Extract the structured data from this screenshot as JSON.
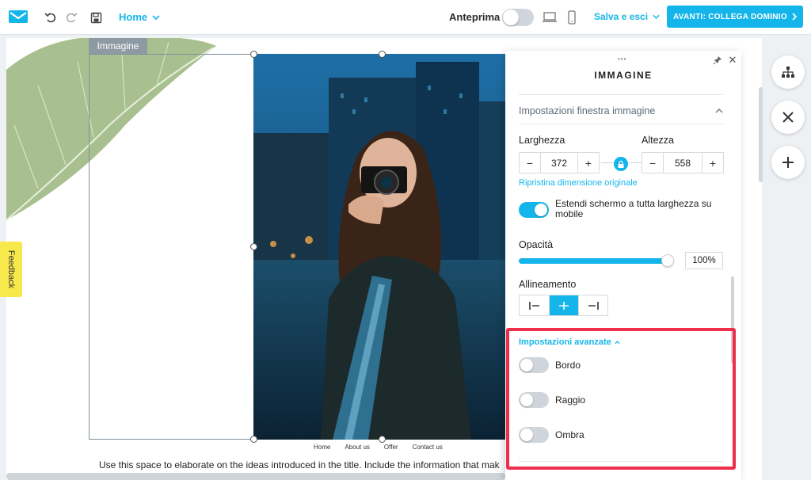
{
  "topbar": {
    "page_selector": "Home",
    "preview_label": "Anteprima",
    "save_label": "Salva e esci",
    "next_label": "AVANTI: COLLEGA DOMINIO"
  },
  "canvas": {
    "image_tag": "Immagine",
    "footer_links": [
      "Home",
      "About us",
      "Offer",
      "Contact us"
    ],
    "body_text": "Use this space to elaborate on the ideas introduced in the title. Include the information that mak"
  },
  "feedback_label": "Feedback",
  "panel": {
    "title": "IMMAGINE",
    "section_title": "Impostazioni finestra immagine",
    "width_label": "Larghezza",
    "height_label": "Altezza",
    "width_value": "372",
    "height_value": "558",
    "reset_link": "Ripristina dimensione originale",
    "fullwidth_label": "Estendi schermo a tutta larghezza su mobile",
    "opacity_label": "Opacità",
    "opacity_value": "100%",
    "opacity_level": 1.0,
    "alignment_label": "Allineamento",
    "advanced_label": "Impostazioni avanzate",
    "toggles": [
      {
        "label": "Bordo",
        "on": false
      },
      {
        "label": "Raggio",
        "on": false
      },
      {
        "label": "Ombra",
        "on": false
      }
    ]
  },
  "colors": {
    "accent": "#13b5ea",
    "highlight": "#ee2e4b",
    "feedback": "#f7e94c"
  }
}
